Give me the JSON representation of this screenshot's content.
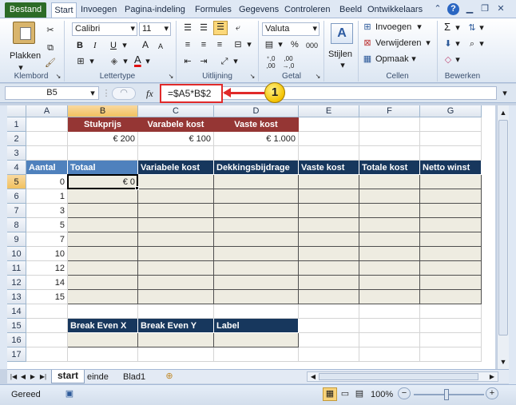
{
  "tabs": {
    "file": "Bestand",
    "home": "Start",
    "insert": "Invoegen",
    "layout": "Pagina-indeling",
    "formulas": "Formules",
    "data": "Gegevens",
    "review": "Controleren",
    "view": "Beeld",
    "developer": "Ontwikkelaars"
  },
  "ribbon": {
    "clipboard": {
      "paste": "Plakken",
      "label": "Klembord"
    },
    "font": {
      "name": "Calibri",
      "size": "11",
      "bold": "B",
      "italic": "I",
      "underline": "U",
      "grow": "A",
      "shrink": "A",
      "color_letter": "A",
      "label": "Lettertype"
    },
    "alignment": {
      "label": "Uitlijning"
    },
    "number": {
      "format": "Valuta",
      "percent": "%",
      "thousands": "000",
      "label": "Getal"
    },
    "styles": {
      "label": "Stijlen"
    },
    "cells": {
      "insert": "Invoegen",
      "delete": "Verwijderen",
      "format": "Opmaak",
      "label": "Cellen"
    },
    "editing": {
      "sigma": "Σ",
      "label": "Bewerken"
    }
  },
  "formula_bar": {
    "name_box": "B5",
    "fx": "fx",
    "formula": "=$A5*B$2",
    "callout": "1"
  },
  "columns": [
    "A",
    "B",
    "C",
    "D",
    "E",
    "F",
    "G"
  ],
  "rows": [
    "1",
    "2",
    "3",
    "4",
    "5",
    "6",
    "7",
    "8",
    "9",
    "10",
    "11",
    "12",
    "13",
    "14",
    "15",
    "16",
    "17"
  ],
  "cells": {
    "B1": "Stukprijs",
    "C1": "Varabele kost",
    "D1": "Vaste kost",
    "B2": "€ 200",
    "C2": "€ 100",
    "D2": "€ 1.000",
    "A4": "Aantal",
    "B4": "Totaal",
    "C4": "Variabele kost",
    "D4": "Dekkingsbijdrage",
    "E4": "Vaste kost",
    "F4": "Totale kost",
    "G4": "Netto winst",
    "B5": "€ 0",
    "A5": "0",
    "A6": "1",
    "A7": "3",
    "A8": "5",
    "A9": "7",
    "A10": "10",
    "A11": "12",
    "A12": "14",
    "A13": "15",
    "B15": "Break Even X",
    "C15": "Break Even Y",
    "D15": "Label"
  },
  "sheets": [
    "start",
    "einde",
    "Blad1"
  ],
  "status": {
    "ready": "Gereed",
    "zoom": "100%"
  },
  "colors": {
    "red_header": "#953634",
    "blue_header": "#4f81bd",
    "navy_header": "#17375d",
    "beige_fill": "#eeece1",
    "accent": "#e03030"
  }
}
